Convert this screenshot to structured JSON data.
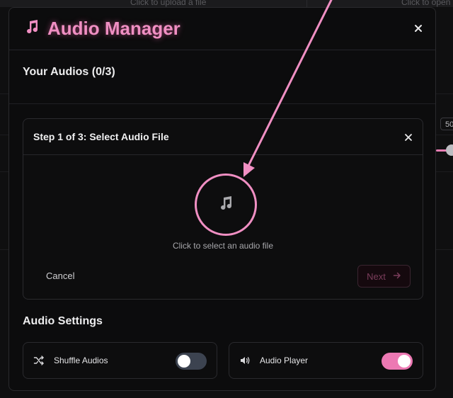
{
  "background": {
    "hint_left": "Click to upload a file",
    "hint_right": "Click to open",
    "right_value": "50"
  },
  "modal": {
    "title": "Audio Manager",
    "title_icon": "music-note-icon",
    "close_icon": "close-icon",
    "audios_title": "Your Audios (0/3)"
  },
  "step": {
    "title": "Step 1 of 3: Select Audio File",
    "upload_icon": "music-note-icon",
    "upload_text": "Click to select an audio file",
    "cancel_label": "Cancel",
    "next_label": "Next",
    "next_icon": "arrow-right-icon"
  },
  "settings": {
    "title": "Audio Settings",
    "shuffle": {
      "label": "Shuffle Audios",
      "icon": "shuffle-icon",
      "enabled": false
    },
    "player": {
      "label": "Audio Player",
      "icon": "volume-icon",
      "enabled": true
    }
  },
  "colors": {
    "accent": "#f08fc3",
    "toggle_on": "#ec79b3",
    "toggle_off": "#3c4350",
    "background": "#0c0c0d"
  }
}
